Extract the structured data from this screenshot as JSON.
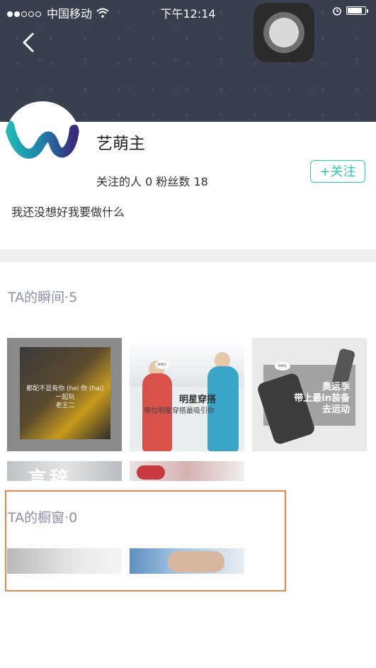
{
  "status_bar": {
    "carrier": "中国移动",
    "time": "下午12:14",
    "battery_level": 0.85
  },
  "header": {
    "back_icon": "chevron-left-icon",
    "assistive_touch_icon": "assistive-touch-icon"
  },
  "profile": {
    "name": "艺萌主",
    "stats": "关注的人 0 粉丝数 18",
    "follow_label": "+关注",
    "bio": "我还没想好我要做什么",
    "accent_color": "#2ec7b4"
  },
  "moments": {
    "title": "TA的瞬间·5",
    "items": [
      {
        "caption": "都配不显有你 (hei 你 (hai)",
        "sub": "一起玩",
        "sub2": "老王二"
      },
      {
        "tag": "AIKIL",
        "headline": "明星穿搭",
        "subline": "哪位明星穿搭最吸引你"
      },
      {
        "tag": "AIKIL",
        "lines": [
          "奥运季",
          "带上最in装备",
          "去运动"
        ]
      },
      {
        "text": "言辞"
      },
      {
        "text": ""
      }
    ]
  },
  "window": {
    "title": "TA的橱窗·0"
  },
  "highlight_color": "#e8874a"
}
